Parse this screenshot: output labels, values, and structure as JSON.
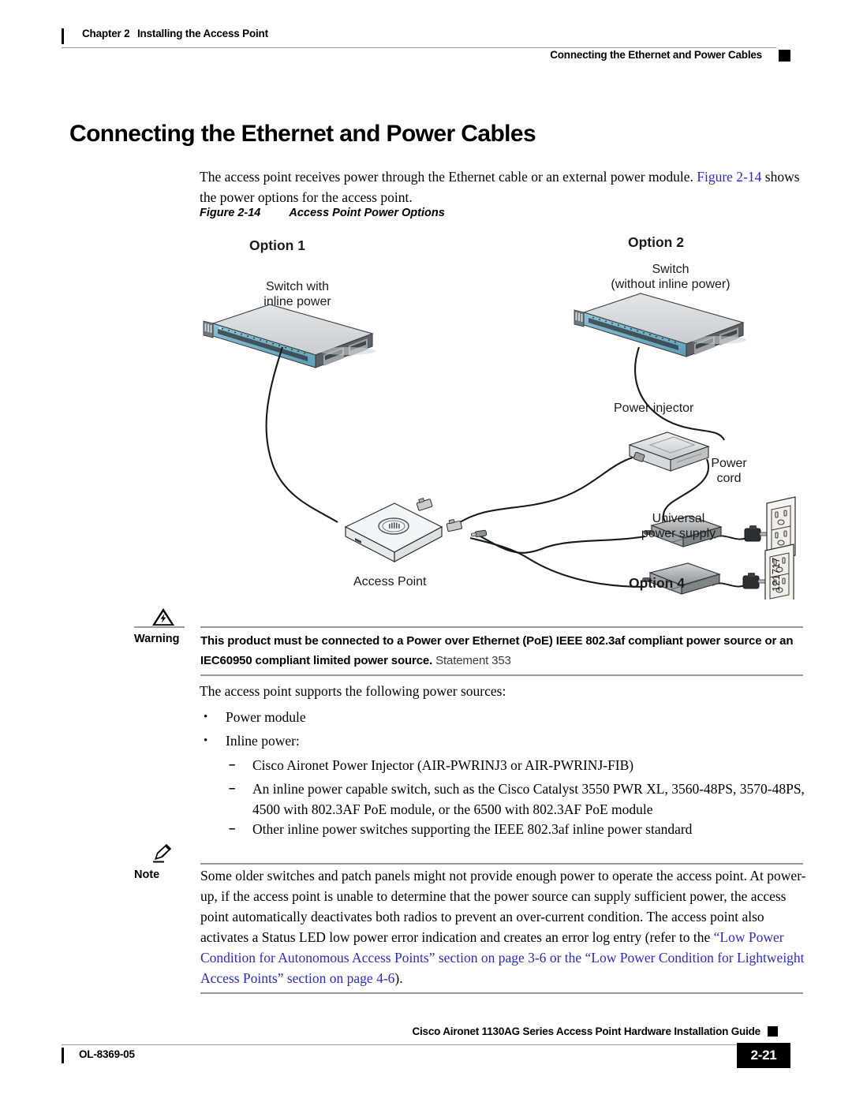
{
  "header": {
    "chapter": "Chapter 2",
    "chapter_title": "Installing the Access Point",
    "section": "Connecting the Ethernet and Power Cables"
  },
  "page": {
    "title": "Connecting the Ethernet and Power Cables",
    "intro_part1": "The access point receives power through the Ethernet cable or an external power module. ",
    "intro_link": "Figure 2-14",
    "intro_part2": " shows the power options for the access point.",
    "link_color": "#2a2ac8"
  },
  "figure": {
    "caption_number": "Figure 2-14",
    "caption_title": "Access Point Power Options",
    "graphic_id": "121717",
    "labels": {
      "option1": "Option 1",
      "option2": "Option 2",
      "option4": "Option 4",
      "switch_with_inline_line1": "Switch with",
      "switch_with_inline_line2": "inline power",
      "switch_without_line1": "Switch",
      "switch_without_line2": "(without inline power)",
      "power_injector": "Power injector",
      "power_cord_line1": "Power",
      "power_cord_line2": "cord",
      "universal_line1": "Universal",
      "universal_line2": "power supply",
      "access_point": "Access Point"
    }
  },
  "warning": {
    "label": "Warning",
    "text_bold": "This product must be connected to a Power over Ethernet (PoE) IEEE 802.3af compliant power source or an IEC60950 compliant limited power source.",
    "statement": " Statement 353"
  },
  "power_sources": {
    "intro": "The access point supports the following power sources:",
    "bullets": [
      {
        "marker": "•",
        "text": "Power module"
      },
      {
        "marker": "•",
        "text": "Inline power:"
      }
    ],
    "dashes": [
      {
        "marker": "–",
        "text": "Cisco Aironet Power Injector (AIR-PWRINJ3 or AIR-PWRINJ-FIB)"
      },
      {
        "marker": "–",
        "text": "An inline power capable switch, such as the Cisco Catalyst 3550 PWR XL, 3560-48PS, 3570-48PS, 4500 with 802.3AF PoE module, or the 6500 with 802.3AF PoE module"
      },
      {
        "marker": "–",
        "text": "Other inline power switches supporting the IEEE 802.3af inline power standard"
      }
    ]
  },
  "note": {
    "label": "Note",
    "text_part1": "Some older switches and patch panels might not provide enough power to operate the access point. At power-up, if the access point is unable to determine that the power source can supply sufficient power, the access point automatically deactivates both radios to prevent an over-current condition. The access point also activates a Status LED low power error indication and creates an error log entry (refer to the ",
    "link1": "“Low Power Condition for Autonomous Access Points” section on page 3-6",
    "text_mid": " or the ",
    "link2": "“Low Power Condition for Lightweight Access Points” section on page 4-6",
    "text_end": ")."
  },
  "footer": {
    "doc_id": "OL-8369-05",
    "guide_title": "Cisco Aironet 1130AG Series Access Point Hardware Installation Guide",
    "page_number": "2-21"
  }
}
